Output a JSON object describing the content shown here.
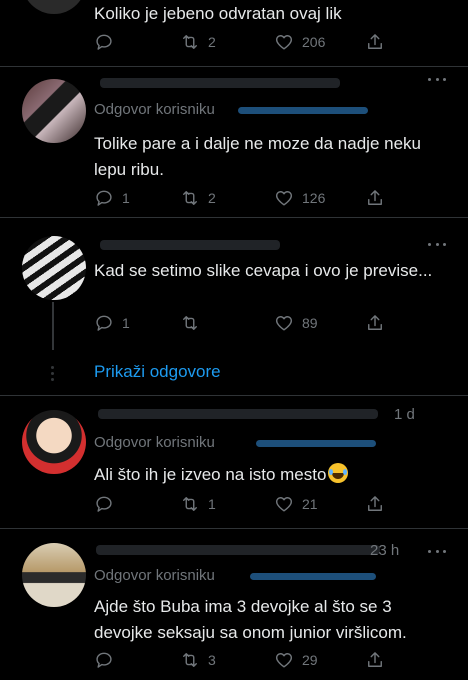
{
  "tweets": [
    {
      "text": "Koliko je jebeno odvratan ovaj lik",
      "retweets": "2",
      "likes": "206"
    },
    {
      "replying_prefix": "Odgovor korisniku",
      "text": "Tolike pare a i dalje ne moze da nadje neku lepu ribu.",
      "replies": "1",
      "retweets": "2",
      "likes": "126"
    },
    {
      "text": "Kad se setimo slike cevapa i ovo je previse...",
      "replies": "1",
      "likes": "89"
    },
    {
      "time": "1 d",
      "replying_prefix": "Odgovor korisniku",
      "text": "Ali što ih je izveo na isto mesto",
      "retweets": "1",
      "likes": "21"
    },
    {
      "time": "23 h",
      "replying_prefix": "Odgovor korisniku",
      "text": "Ajde što Buba ima 3 devojke al što se 3 devojke seksaju sa onom junior viršlicom.",
      "retweets": "3",
      "likes": "29"
    }
  ],
  "show_replies": "Prikaži odgovore",
  "icons": [
    "reply-icon",
    "retweet-icon",
    "like-icon",
    "share-icon",
    "more-icon"
  ],
  "colors": {
    "background": "#000000",
    "text": "#e7e9ea",
    "muted": "#71767b",
    "accent": "#1d9bf0",
    "divider": "#2f3336"
  }
}
